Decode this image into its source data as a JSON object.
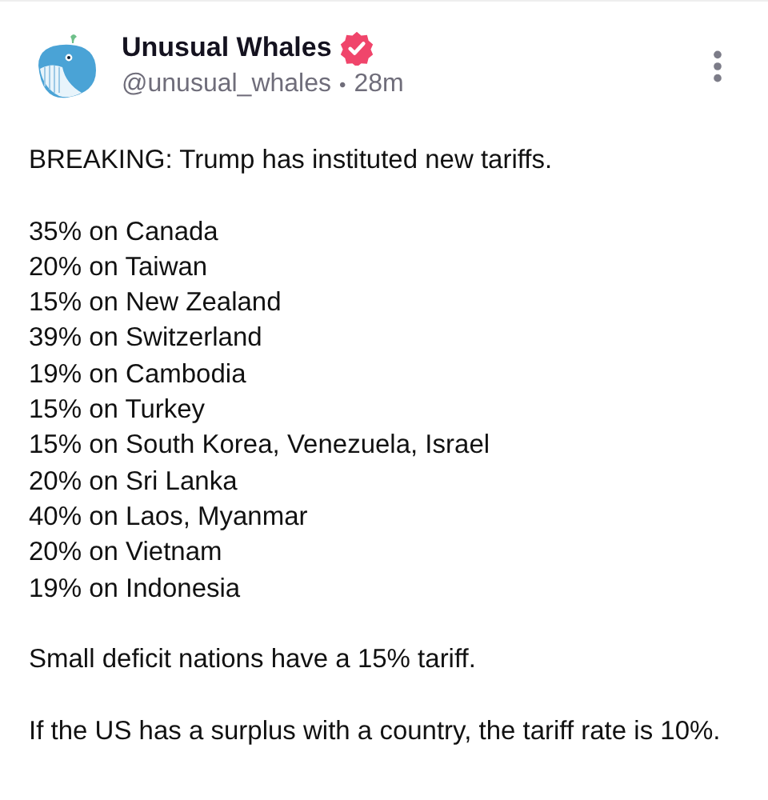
{
  "post": {
    "author": "Unusual Whales",
    "verified": true,
    "handle": "@unusual_whales",
    "separator": "•",
    "time": "28m",
    "paragraphs": [
      "BREAKING: Trump has instituted new tariffs.",
      "35% on Canada\n20% on Taiwan\n15% on New Zealand\n39% on Switzerland\n19% on Cambodia\n15% on Turkey\n15% on South Korea, Venezuela, Israel\n20% on Sri Lanka\n40% on Laos, Myanmar\n20% on Vietnam\n19% on Indonesia",
      "Small deficit nations have a 15% tariff.",
      "If the US has a surplus with a country, the tariff rate is 10%."
    ]
  }
}
